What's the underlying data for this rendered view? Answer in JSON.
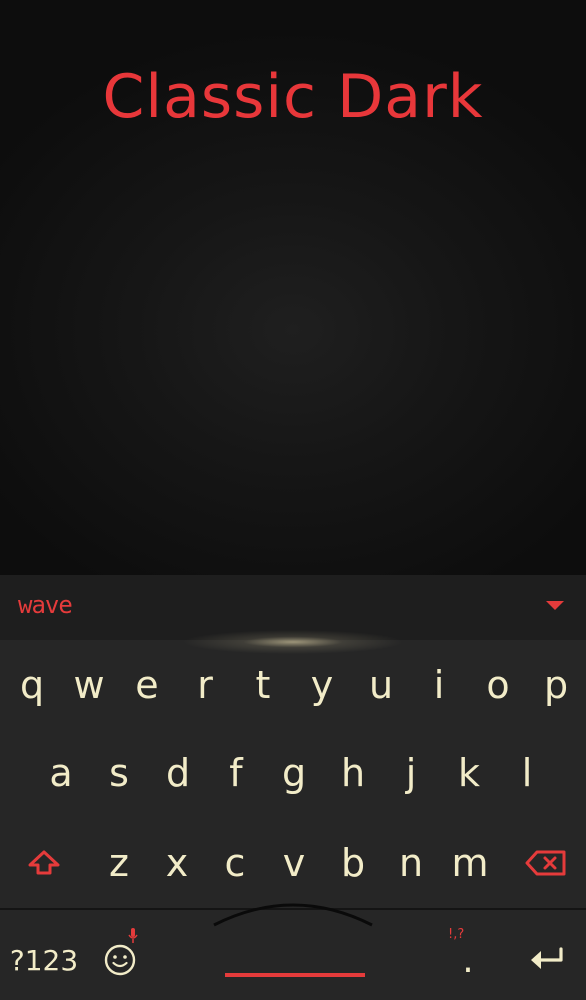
{
  "theme": {
    "title": "Classic Dark",
    "accent_color": "#e53b3b",
    "key_text_color": "#f2ecc8"
  },
  "toolbar": {
    "brand": "wave",
    "collapse_icon": "chevron-down-icon"
  },
  "keys": {
    "row1": [
      "q",
      "w",
      "e",
      "r",
      "t",
      "y",
      "u",
      "i",
      "o",
      "p"
    ],
    "row2": [
      "a",
      "s",
      "d",
      "f",
      "g",
      "h",
      "j",
      "k",
      "l"
    ],
    "row3": [
      "z",
      "x",
      "c",
      "v",
      "b",
      "n",
      "m"
    ],
    "shift_icon": "shift-up-arrow-icon",
    "backspace_icon": "backspace-icon",
    "symbols_label": "?123",
    "emoji_icon": "smiley-icon",
    "mic_icon": "microphone-icon",
    "punct_hint": "!,?",
    "period_label": ".",
    "enter_icon": "enter-arrow-icon"
  }
}
